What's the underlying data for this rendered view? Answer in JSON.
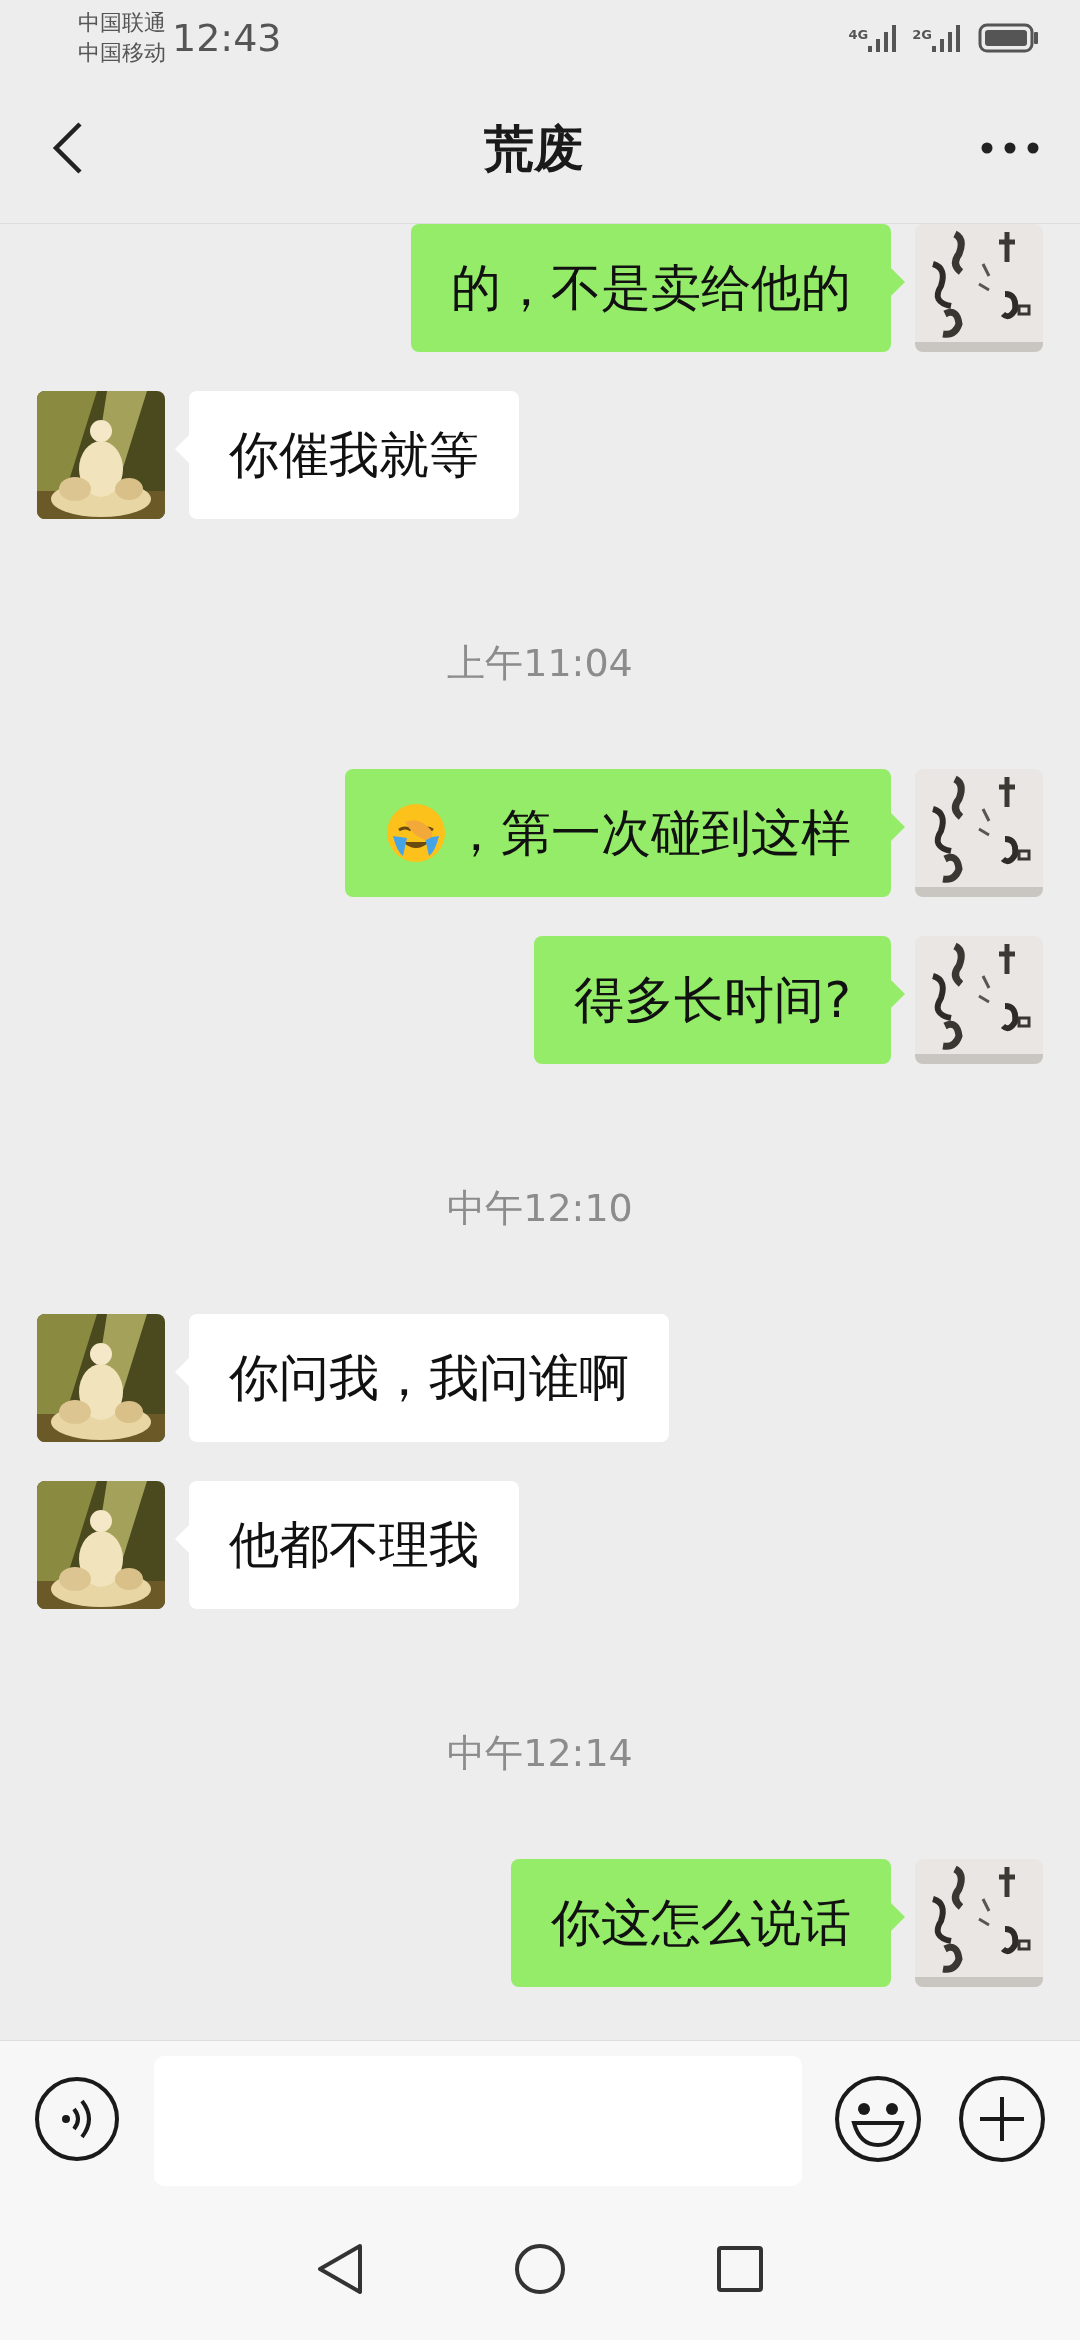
{
  "status_bar": {
    "carriers": [
      "中国联通",
      "中国移动"
    ],
    "time": "12:43",
    "networks": [
      "4G",
      "2G"
    ]
  },
  "header": {
    "title": "荒废"
  },
  "messages": [
    {
      "kind": "sent",
      "text": "的，不是卖给他的",
      "leading_emoji": false
    },
    {
      "kind": "received",
      "text": "你催我就等",
      "leading_emoji": false
    },
    {
      "kind": "time",
      "text": "上午11:04"
    },
    {
      "kind": "sent",
      "text": "，第一次碰到这样",
      "leading_emoji": true
    },
    {
      "kind": "sent",
      "text": "得多长时间?",
      "leading_emoji": false
    },
    {
      "kind": "time",
      "text": "中午12:10"
    },
    {
      "kind": "received",
      "text": "你问我，我问谁啊",
      "leading_emoji": false
    },
    {
      "kind": "received",
      "text": "他都不理我",
      "leading_emoji": false
    },
    {
      "kind": "time",
      "text": "中午12:14"
    },
    {
      "kind": "sent",
      "text": "你这怎么说话",
      "leading_emoji": false
    }
  ]
}
